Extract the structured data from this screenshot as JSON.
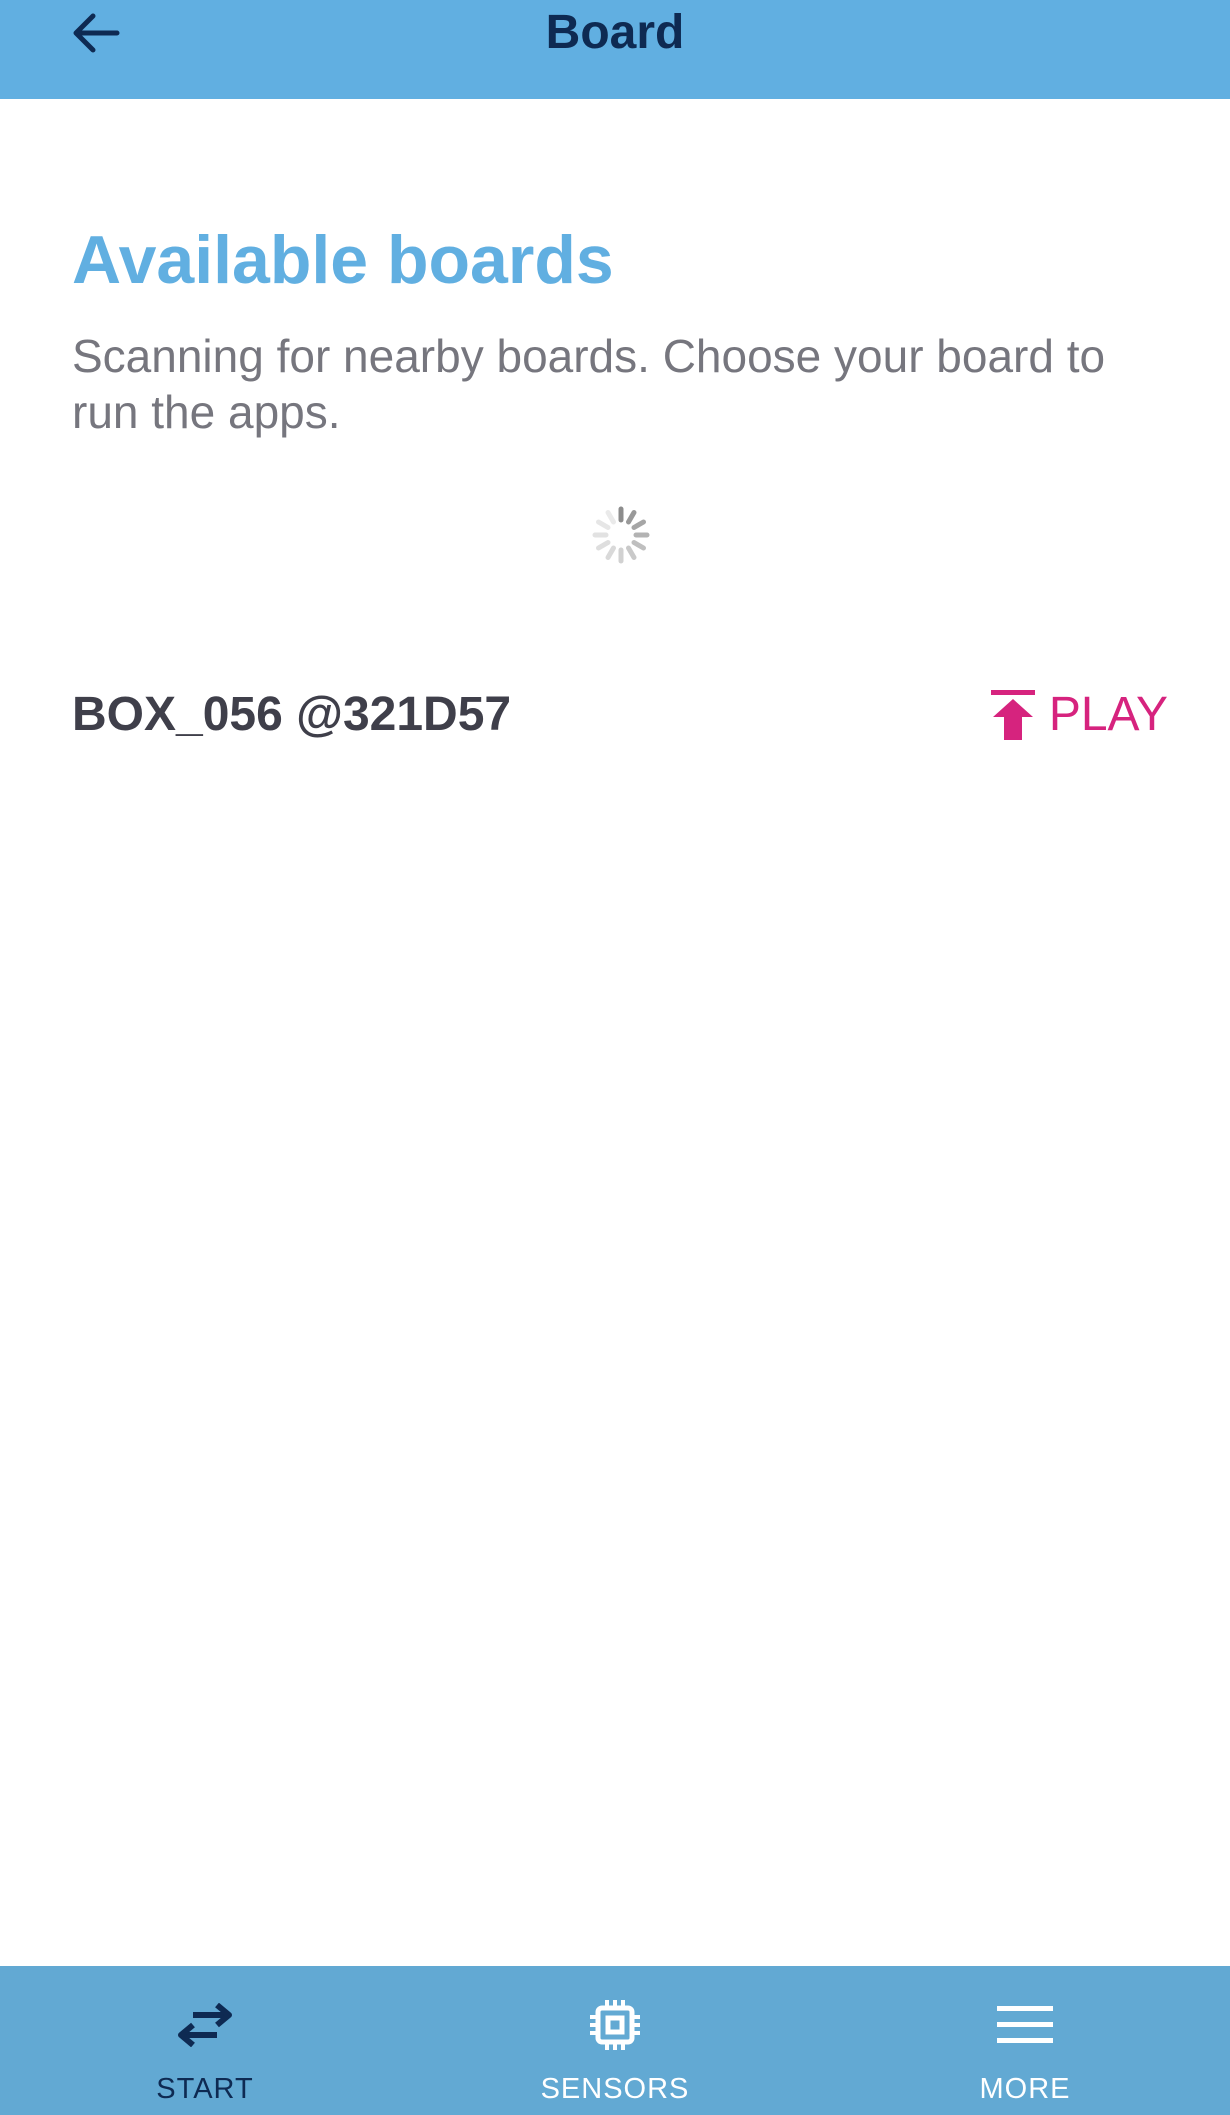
{
  "header": {
    "title": "Board",
    "back_icon": "arrow-left-icon",
    "background": "#61afe1",
    "title_color": "#0e2a52"
  },
  "main": {
    "title": "Available boards",
    "description": "Scanning for nearby boards. Choose your board to run the apps.",
    "scanning_indicator": "spinner-icon",
    "boards": [
      {
        "name": "BOX_056 @321D57",
        "action_label": "PLAY",
        "action_icon": "upload-arrow-icon"
      }
    ]
  },
  "bottom_nav": {
    "items": [
      {
        "label": "START",
        "icon": "swap-arrows-icon",
        "active": true
      },
      {
        "label": "SENSORS",
        "icon": "chip-icon",
        "active": false
      },
      {
        "label": "MORE",
        "icon": "menu-icon",
        "active": false
      }
    ]
  },
  "colors": {
    "accent": "#61afe1",
    "play": "#d6237e",
    "nav_background": "#62a9d3",
    "active_nav": "#0e2a52"
  }
}
